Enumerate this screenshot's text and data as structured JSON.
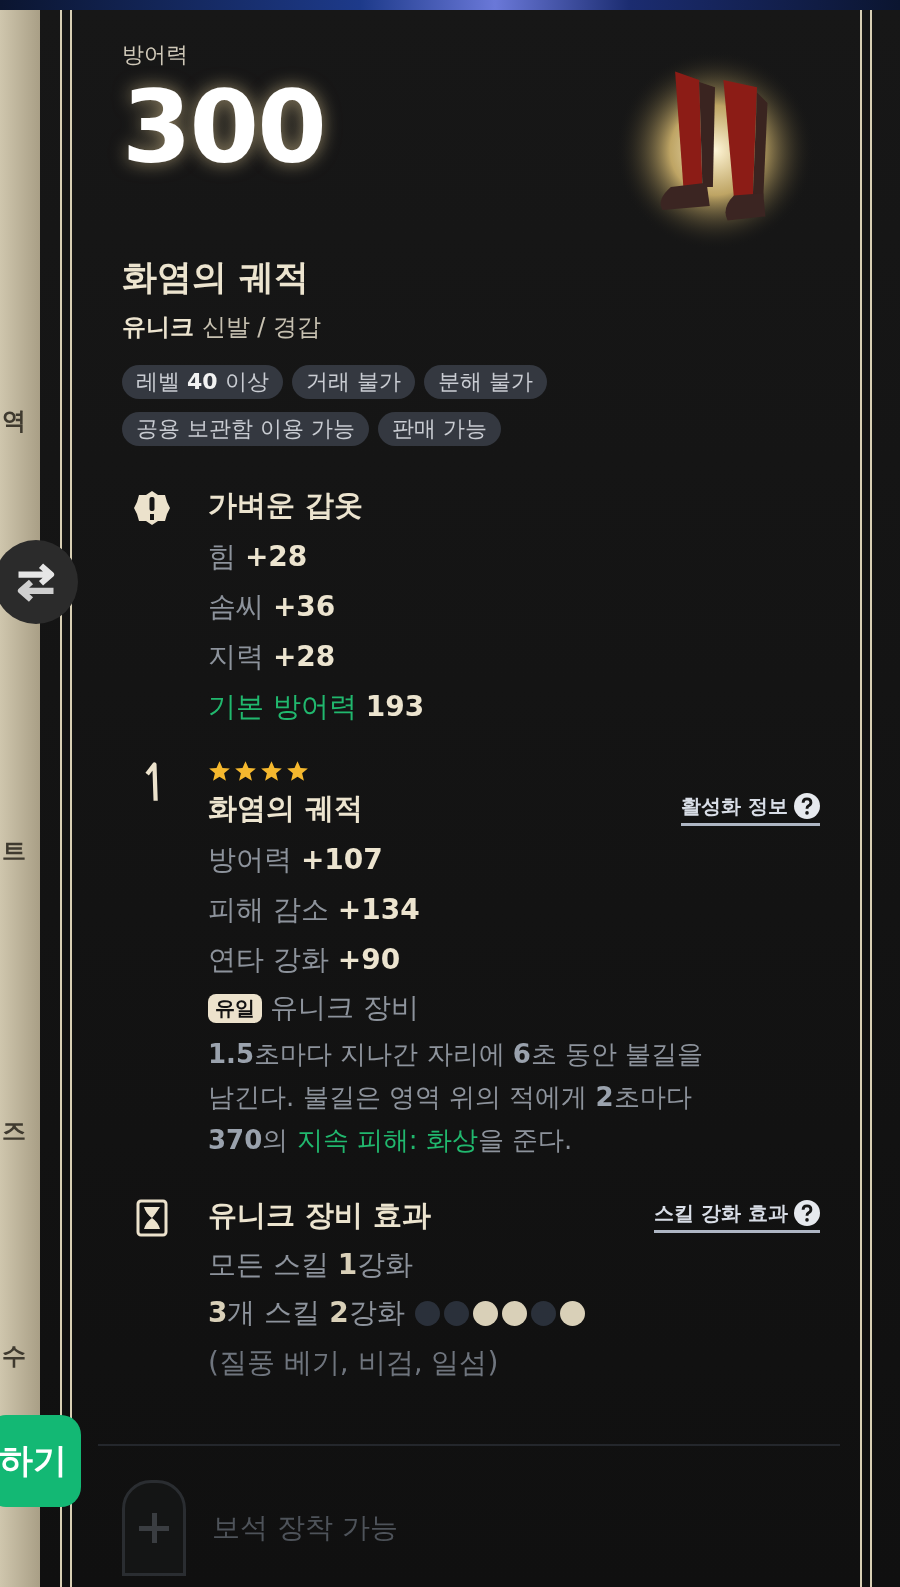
{
  "side_panel": {
    "texts": [
      "역",
      "트",
      "즈",
      "수"
    ],
    "action_button": "하기"
  },
  "item": {
    "stat_label": "방어력",
    "stat_value": "300",
    "name": "화염의 궤적",
    "type_line": "**유니크** 신발 / 경갑",
    "tags": [
      [
        "레벨 **40** 이상",
        "거래 불가",
        "분해 불가"
      ],
      [
        "공용 보관함 이용 가능",
        "판매 가능"
      ]
    ]
  },
  "sections": [
    {
      "kind": "base",
      "title": "가벼운 갑옷",
      "lines": [
        {
          "label": "힘",
          "value": "+28",
          "green": false
        },
        {
          "label": "솜씨",
          "value": "+36",
          "green": false
        },
        {
          "label": "지력",
          "value": "+28",
          "green": false
        },
        {
          "label": "기본 방어력",
          "value": "193",
          "green": true
        }
      ]
    },
    {
      "kind": "set",
      "stars": 4,
      "title": "화염의 궤적",
      "link": "활성화 정보",
      "lines": [
        {
          "label": "방어력",
          "value": "+107",
          "green": false
        },
        {
          "label": "피해 감소",
          "value": "+134",
          "green": false
        },
        {
          "label": "연타 강화",
          "value": "+90",
          "green": false
        }
      ],
      "badge": "유일",
      "badge_text": "유니크 장비",
      "description": [
        {
          "text": "1.5",
          "kind": "num"
        },
        {
          "text": "초마다 지나간 자리에 ",
          "kind": "text"
        },
        {
          "text": "6",
          "kind": "num"
        },
        {
          "text": "초 동안 불길을 남긴다. 불길은 영역 위의 적에게 ",
          "kind": "text"
        },
        {
          "text": "2",
          "kind": "num"
        },
        {
          "text": "초마다 ",
          "kind": "text"
        },
        {
          "text": "370",
          "kind": "num"
        },
        {
          "text": "의 ",
          "kind": "text"
        },
        {
          "text": "지속 피해: 화상",
          "kind": "keyword"
        },
        {
          "text": "을 준다.",
          "kind": "text"
        }
      ]
    },
    {
      "kind": "skill",
      "title": "유니크 장비 효과",
      "link": "스킬 강화 효과",
      "skill_lines": [
        "모든 스킬 **1**강화",
        "**3**개 스킬 **2**강화"
      ],
      "dots": [
        {
          "on": false
        },
        {
          "on": false
        },
        {
          "on": true
        },
        {
          "on": true
        },
        {
          "on": false
        },
        {
          "on": true
        }
      ],
      "note": "(질풍 베기, 비검, 일섬)"
    }
  ],
  "socket": {
    "label": "보석 장착 가능"
  }
}
